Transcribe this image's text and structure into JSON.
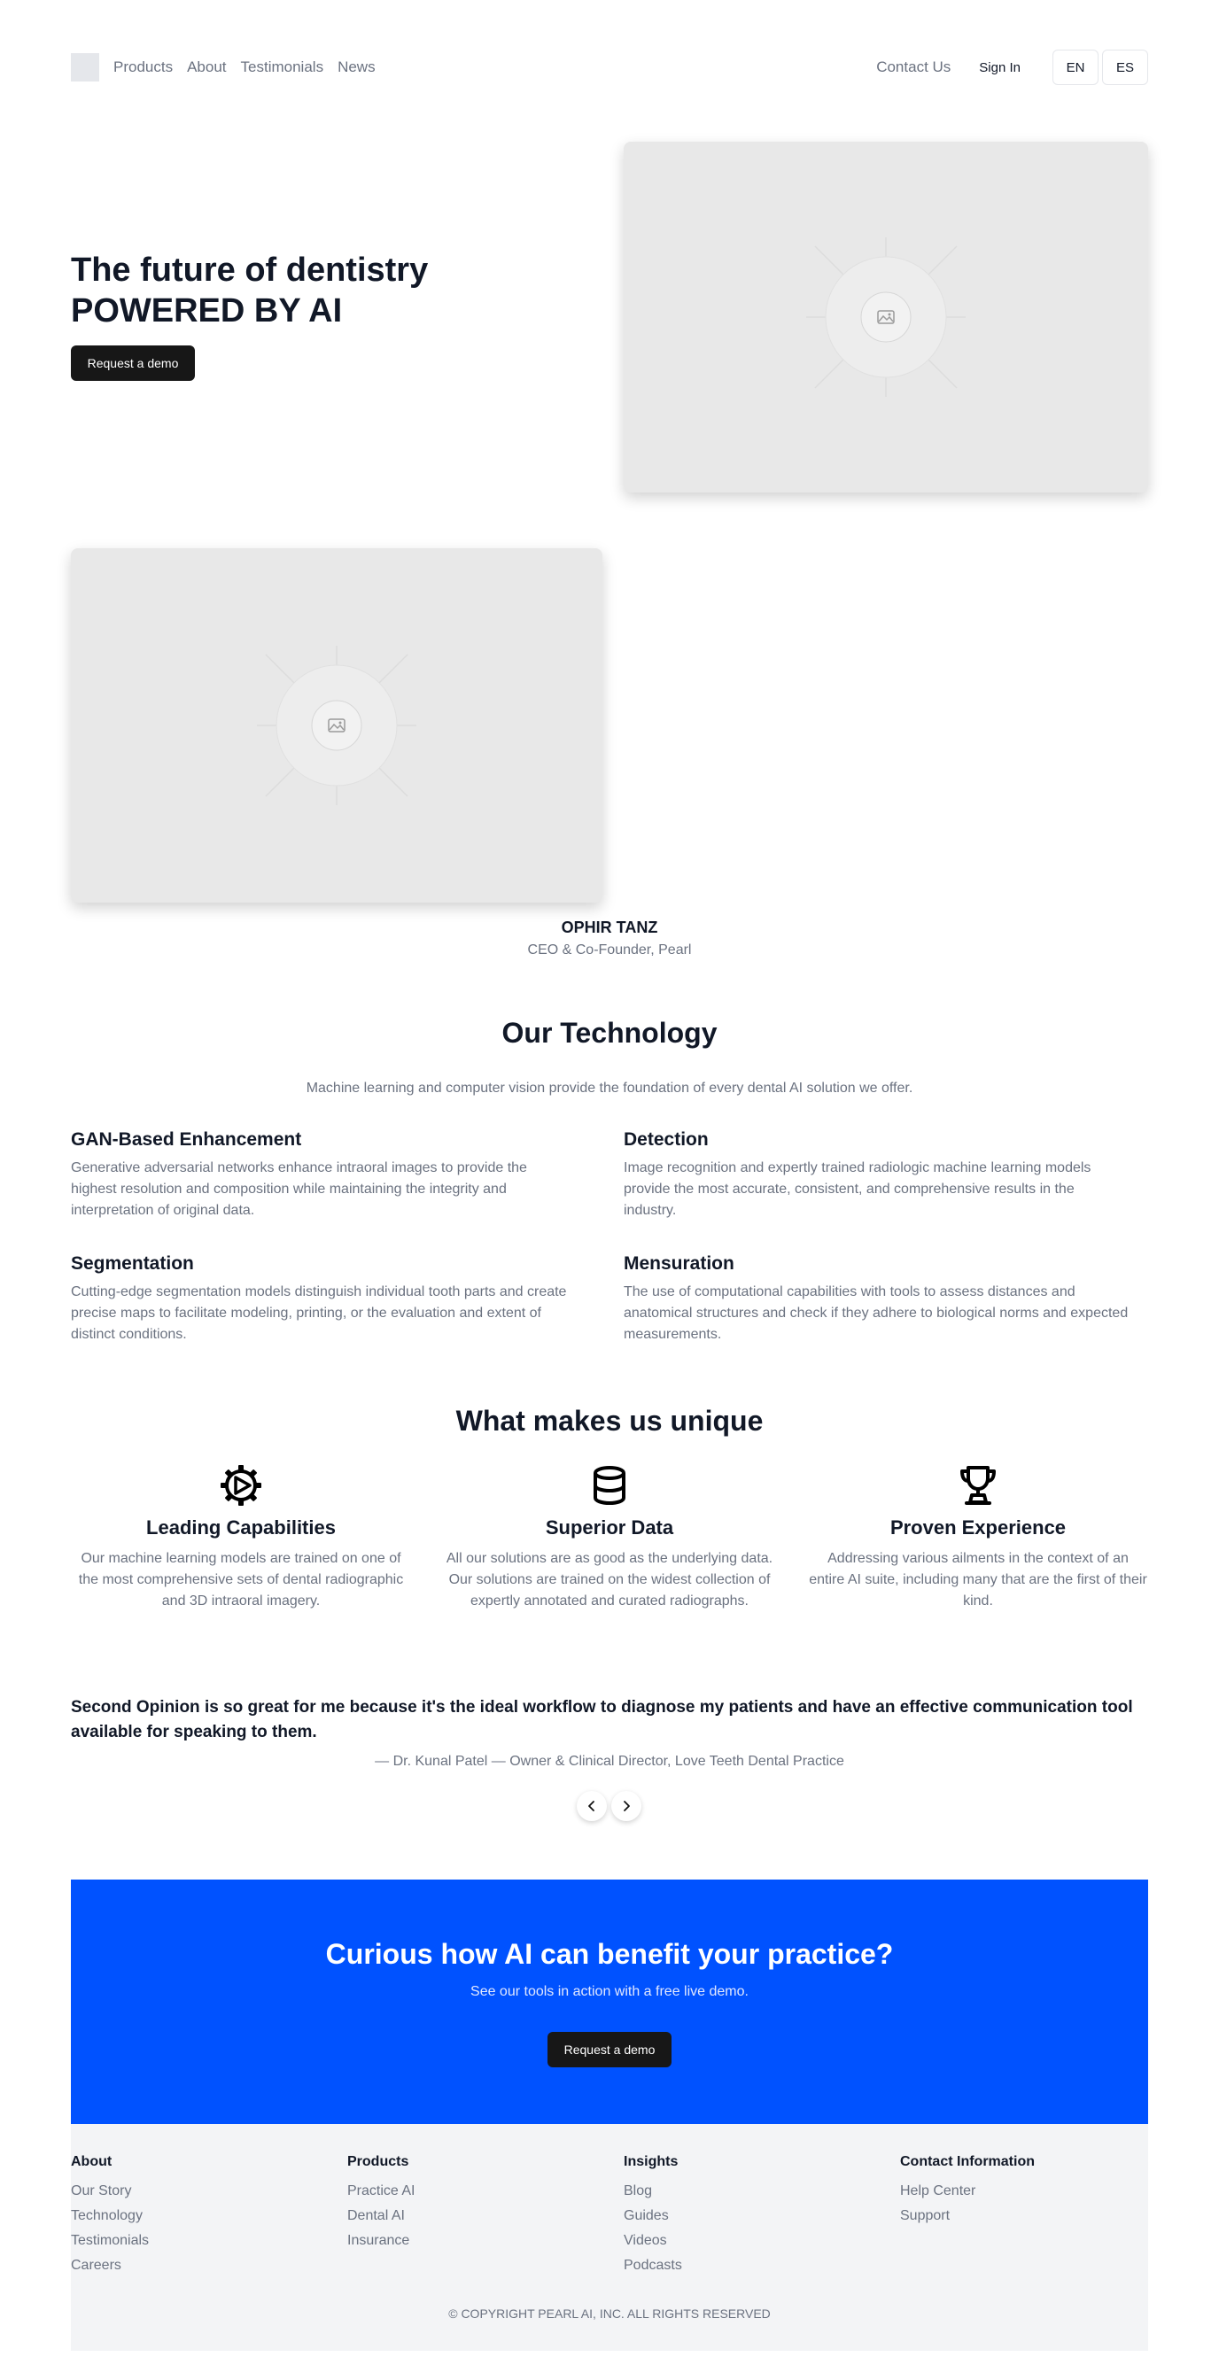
{
  "header": {
    "nav": [
      "Products",
      "About",
      "Testimonials",
      "News"
    ],
    "contact": "Contact Us",
    "sign_in": "Sign In",
    "languages": [
      "EN",
      "ES"
    ]
  },
  "hero": {
    "title_line1": "The future of dentistry",
    "title_line2": "POWERED BY AI",
    "cta": "Request a demo"
  },
  "founder": {
    "name": "OPHIR TANZ",
    "role": "CEO & Co-Founder, Pearl"
  },
  "technology": {
    "title": "Our Technology",
    "subtitle": "Machine learning and computer vision provide the foundation of every dental AI solution we offer.",
    "items": [
      {
        "title": "GAN-Based Enhancement",
        "text": "Generative adversarial networks enhance intraoral images to provide the highest resolution and composition while maintaining the integrity and interpretation of original data."
      },
      {
        "title": "Detection",
        "text": "Image recognition and expertly trained radiologic machine learning models provide the most accurate, consistent, and comprehensive results in the industry."
      },
      {
        "title": "Segmentation",
        "text": "Cutting-edge segmentation models distinguish individual tooth parts and create precise maps to facilitate modeling, printing, or the evaluation and extent of distinct conditions."
      },
      {
        "title": "Mensuration",
        "text": "The use of computational capabilities with tools to assess distances and anatomical structures and check if they adhere to biological norms and expected measurements."
      }
    ]
  },
  "unique": {
    "title": "What makes us unique",
    "items": [
      {
        "icon": "gear-play-icon",
        "title": "Leading Capabilities",
        "text": "Our machine learning models are trained on one of the most comprehensive sets of dental radiographic and 3D intraoral imagery."
      },
      {
        "icon": "database-icon",
        "title": "Superior Data",
        "text": "All our solutions are as good as the underlying data. Our solutions are trained on the widest collection of expertly annotated and curated radiographs."
      },
      {
        "icon": "trophy-icon",
        "title": "Proven Experience",
        "text": "Addressing various ailments in the context of an entire AI suite, including many that are the first of their kind."
      }
    ]
  },
  "testimonial": {
    "quote": "Second Opinion is so great for me because it's the ideal workflow to diagnose my patients and have an effective communication tool available for speaking to them.",
    "author": "— Dr. Kunal Patel — Owner & Clinical Director, Love Teeth Dental Practice"
  },
  "cta": {
    "title": "Curious how AI can benefit your practice?",
    "subtitle": "See our tools in action with a free live demo.",
    "button": "Request a demo"
  },
  "footer": {
    "columns": [
      {
        "title": "About",
        "links": [
          "Our Story",
          "Technology",
          "Testimonials",
          "Careers"
        ]
      },
      {
        "title": "Products",
        "links": [
          "Practice AI",
          "Dental AI",
          "Insurance"
        ]
      },
      {
        "title": "Insights",
        "links": [
          "Blog",
          "Guides",
          "Videos",
          "Podcasts"
        ]
      },
      {
        "title": "Contact Information",
        "links": [
          "Help Center",
          "Support"
        ]
      }
    ],
    "copyright": "© COPYRIGHT PEARL AI, INC. ALL RIGHTS RESERVED"
  },
  "colors": {
    "cta_background": "#0052ff",
    "button_dark": "#171717",
    "footer_background": "#f3f4f6"
  }
}
